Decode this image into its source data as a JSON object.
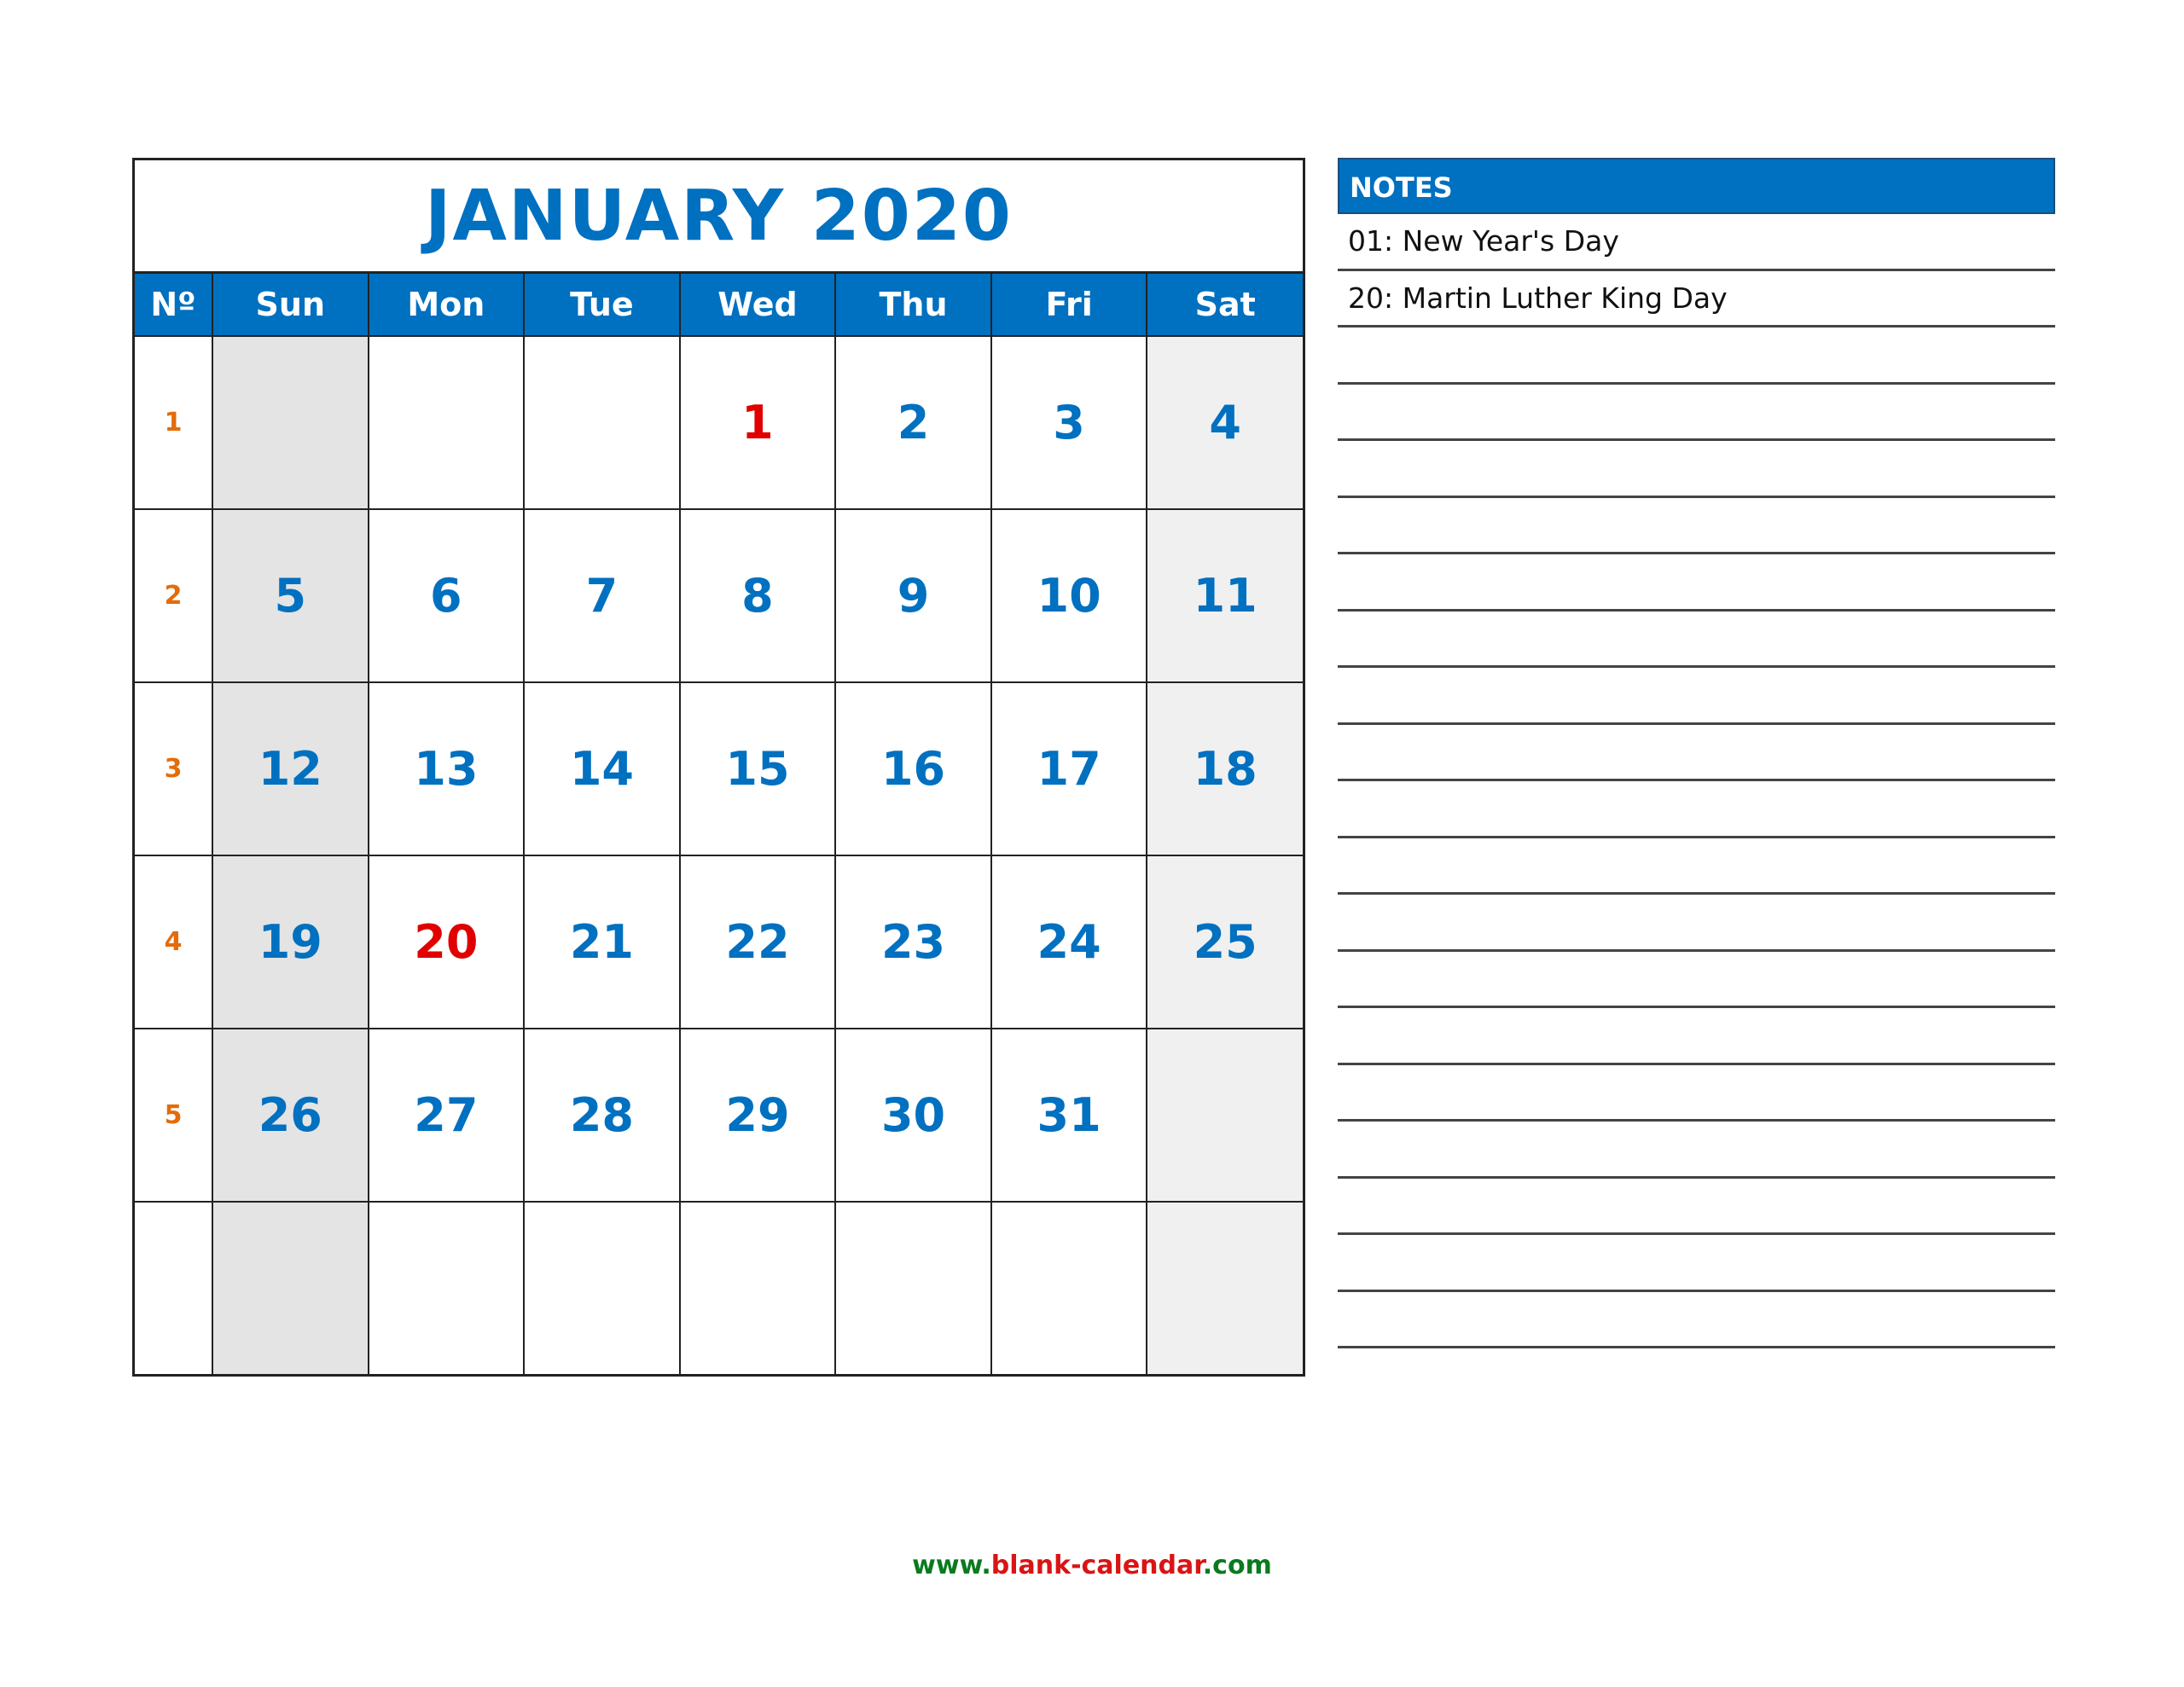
{
  "calendar": {
    "title": "JANUARY 2020",
    "week_header": "Nº",
    "days": [
      "Sun",
      "Mon",
      "Tue",
      "Wed",
      "Thu",
      "Fri",
      "Sat"
    ],
    "weeks": [
      {
        "no": "1",
        "dates": [
          "",
          "",
          "",
          "1",
          "2",
          "3",
          "4"
        ]
      },
      {
        "no": "2",
        "dates": [
          "5",
          "6",
          "7",
          "8",
          "9",
          "10",
          "11"
        ]
      },
      {
        "no": "3",
        "dates": [
          "12",
          "13",
          "14",
          "15",
          "16",
          "17",
          "18"
        ]
      },
      {
        "no": "4",
        "dates": [
          "19",
          "20",
          "21",
          "22",
          "23",
          "24",
          "25"
        ]
      },
      {
        "no": "5",
        "dates": [
          "26",
          "27",
          "28",
          "29",
          "30",
          "31",
          ""
        ]
      },
      {
        "no": "",
        "dates": [
          "",
          "",
          "",
          "",
          "",
          "",
          ""
        ]
      }
    ],
    "holidays": [
      "1",
      "20"
    ],
    "colors": {
      "accent": "#0070c0",
      "week_number": "#e36c0a",
      "holiday": "#e00000"
    }
  },
  "notes": {
    "title": "NOTES",
    "lines": [
      "01: New Year's Day",
      "20: Martin Luther King Day",
      "",
      "",
      "",
      "",
      "",
      "",
      "",
      "",
      "",
      "",
      "",
      "",
      "",
      "",
      "",
      "",
      "",
      ""
    ]
  },
  "footer": {
    "prefix": "www.",
    "name": "blank-calendar",
    "suffix": ".com"
  }
}
